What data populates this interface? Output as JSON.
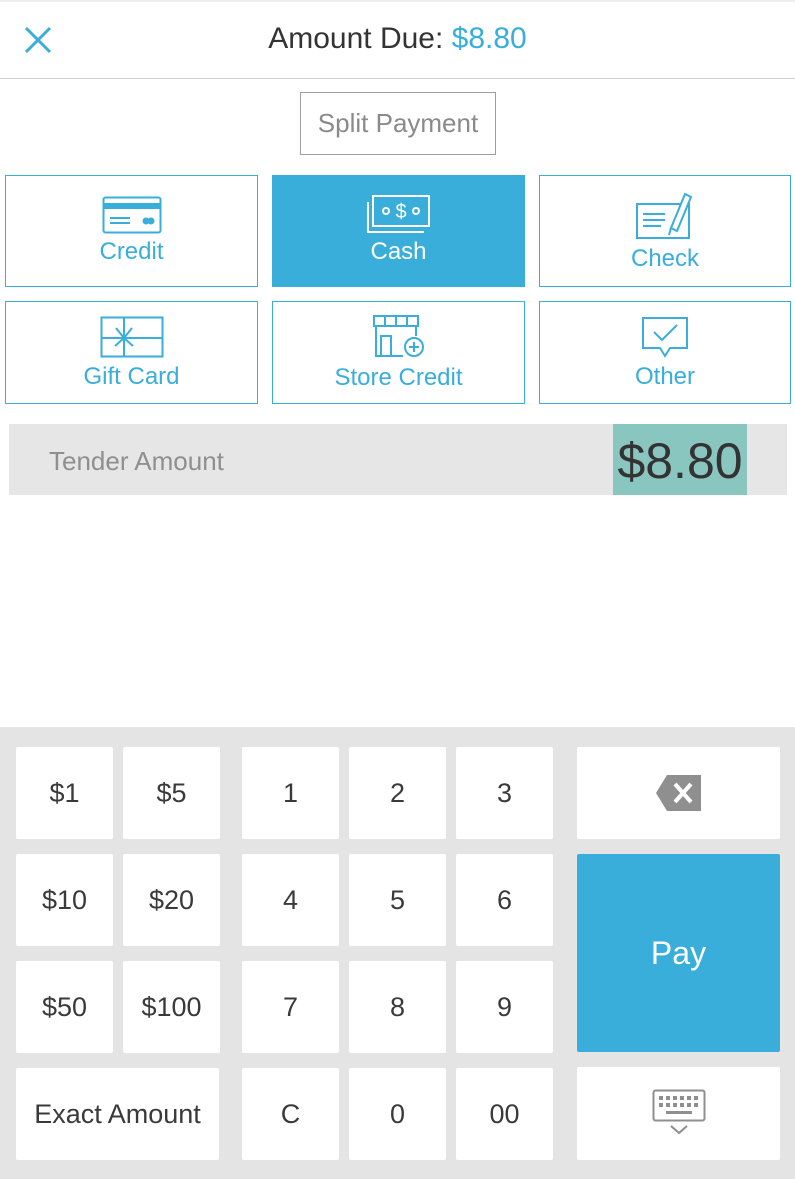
{
  "header": {
    "title_label": "Amount Due:",
    "title_amount": "$8.80",
    "close_icon": "close-icon"
  },
  "split_payment_label": "Split Payment",
  "payment_types": [
    {
      "label": "Credit",
      "icon": "credit-card-icon",
      "active": false
    },
    {
      "label": "Cash",
      "icon": "cash-icon",
      "active": true
    },
    {
      "label": "Check",
      "icon": "check-icon",
      "active": false
    },
    {
      "label": "Gift Card",
      "icon": "gift-card-icon",
      "active": false
    },
    {
      "label": "Store Credit",
      "icon": "store-credit-icon",
      "active": false
    },
    {
      "label": "Other",
      "icon": "other-icon",
      "active": false
    }
  ],
  "tender": {
    "label": "Tender Amount",
    "value": "$8.80"
  },
  "keypad": {
    "quick": [
      "$1",
      "$5",
      "$10",
      "$20",
      "$50",
      "$100"
    ],
    "exact": "Exact Amount",
    "digits": [
      "1",
      "2",
      "3",
      "4",
      "5",
      "6",
      "7",
      "8",
      "9"
    ],
    "clear": "C",
    "zero": "0",
    "double_zero": "00",
    "pay": "Pay",
    "backspace_icon": "backspace-icon",
    "keyboard_icon": "keyboard-icon"
  },
  "colors": {
    "accent": "#39aedb",
    "highlight": "#8ac6c0",
    "keypad_bg": "#e4e4e4"
  }
}
